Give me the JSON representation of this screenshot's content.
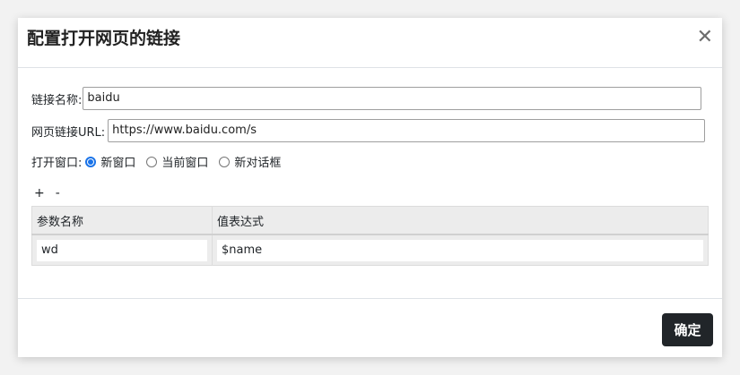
{
  "dialog": {
    "title": "配置打开网页的链接",
    "close_symbol": "✕"
  },
  "form": {
    "link_name_label": "链接名称:",
    "link_name_value": "baidu",
    "url_label": "网页链接URL:",
    "url_value": "https://www.baidu.com/s",
    "open_window_label": "打开窗口:",
    "radio_options": [
      {
        "label": "新窗口",
        "checked": true
      },
      {
        "label": "当前窗口",
        "checked": false
      },
      {
        "label": "新对话框",
        "checked": false
      }
    ]
  },
  "params": {
    "add_symbol": "+",
    "remove_symbol": "-",
    "columns": [
      "参数名称",
      "值表达式"
    ],
    "rows": [
      {
        "name": "wd",
        "expr": "$name"
      }
    ]
  },
  "footer": {
    "ok_label": "确定"
  }
}
